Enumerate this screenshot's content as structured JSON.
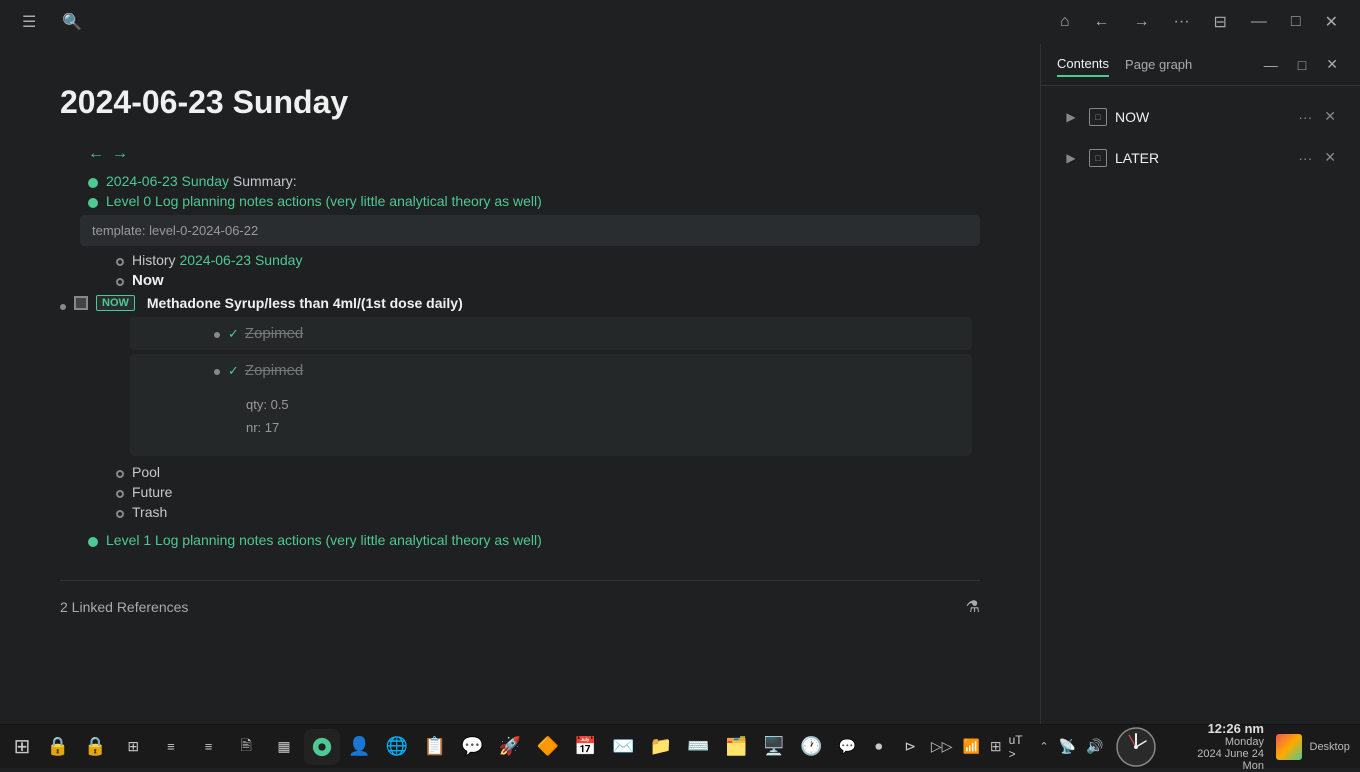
{
  "page": {
    "title": "2024-06-23 Sunday",
    "nav_arrows": [
      "←",
      "→"
    ],
    "summary_line": "Summary:",
    "date_link": "2024-06-23 Sunday",
    "level0_link": "Level 0 Log planning notes actions (very little analytical theory as well)",
    "template_text": "template: level-0-2024-06-22",
    "history_label": "History",
    "history_link": "2024-06-23 Sunday",
    "now_label": "Now",
    "now_badge": "NOW",
    "methadone_text": "Methadone Syrup/less than 4ml/(1st dose daily)",
    "zopimed_text": "Zopimed",
    "qty_label": "qty:",
    "qty_value": "0.5",
    "nr_label": "nr:",
    "nr_value": "17",
    "pool_label": "Pool",
    "future_label": "Future",
    "trash_label": "Trash",
    "level1_link": "Level 1 Log planning notes actions (very little analytical theory as well)",
    "linked_refs_count": "2 Linked References"
  },
  "sidebar": {
    "tab_contents": "Contents",
    "tab_page_graph": "Page graph",
    "items": [
      {
        "label": "NOW",
        "id": "now"
      },
      {
        "label": "LATER",
        "id": "later"
      }
    ]
  },
  "topbar": {
    "home_icon": "⌂",
    "back_icon": "←",
    "forward_icon": "→",
    "more_icon": "···",
    "sidebar_icon": "⊟",
    "minimize_icon": "—",
    "maximize_icon": "□",
    "close_icon": "✕"
  },
  "taskbar": {
    "start_icon": "⊞",
    "time": "12:26 nm",
    "day": "Monday",
    "date": "2024 June 24 Mon",
    "ut_label": "uT >",
    "desktop_label": "Desktop"
  },
  "taskbar_apps": [
    {
      "icon": "🔒",
      "name": "lock"
    },
    {
      "icon": "🔒",
      "name": "lock2"
    },
    {
      "icon": "⊞",
      "name": "grid"
    },
    {
      "icon": "≡",
      "name": "menu"
    },
    {
      "icon": "≡",
      "name": "menu2"
    },
    {
      "icon": "🖹",
      "name": "file"
    },
    {
      "icon": "▦",
      "name": "grid2"
    }
  ]
}
